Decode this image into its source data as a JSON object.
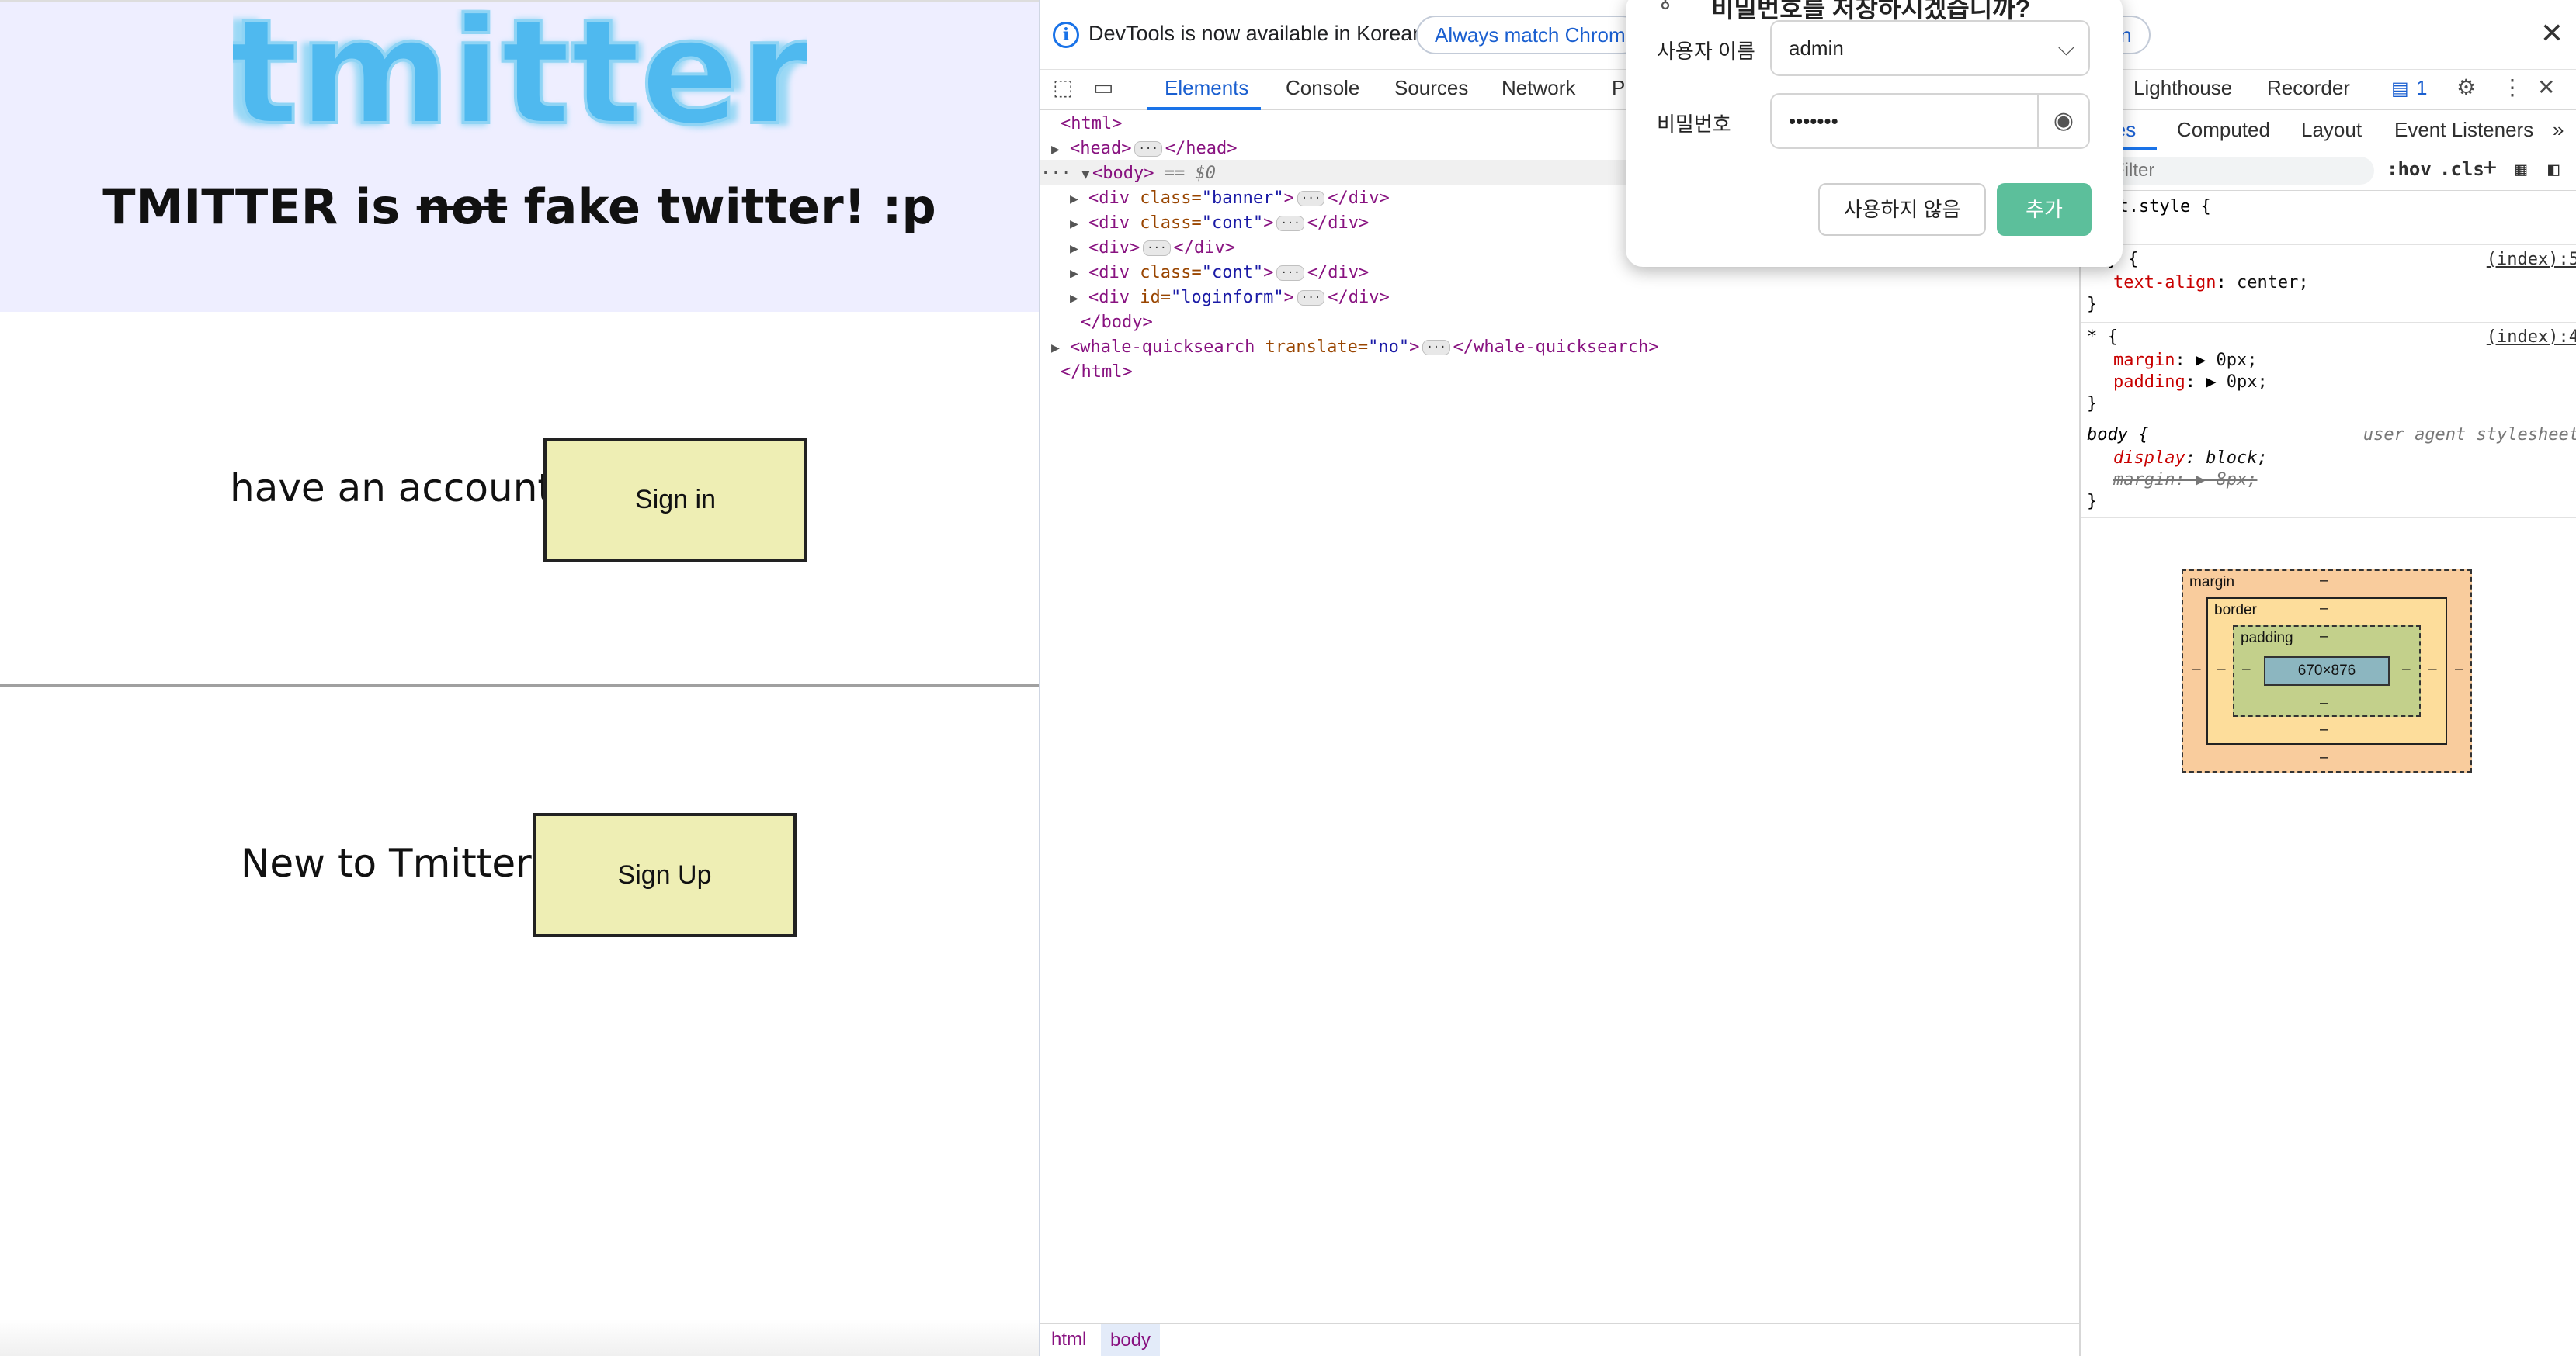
{
  "page": {
    "logo_text": "tmitter",
    "tagline_prefix": "TMITTER is ",
    "tagline_strike": "not",
    "tagline_suffix": " fake twitter! :p",
    "login_prompt": "have an account?",
    "signin_label": "Sign in",
    "signup_prompt": "New to Tmitter?",
    "signup_label": "Sign Up"
  },
  "devtools": {
    "info_text": "DevTools is now available in Korean!",
    "info_btn_match": "Always match Chrome's language",
    "info_btn_again": "w again",
    "tabs": [
      "Elements",
      "Console",
      "Sources",
      "Network",
      "Pe",
      "Lighthouse",
      "Recorder"
    ],
    "issues_count": "1",
    "dom": {
      "html_open": "<html>",
      "head": "<head>",
      "head_close": "</head>",
      "body_open": "<body>",
      "body_eq": " == $0",
      "div": "<div",
      "class_attr": " class=",
      "id_attr": " id=",
      "banner_val": "\"banner\"",
      "cont_val": "\"cont\"",
      "loginform_val": "\"loginform\"",
      "gt": ">",
      "div_plain": "<div>",
      "div_close": "</div>",
      "body_close": "</body>",
      "whale_open": "<whale-quicksearch",
      "translate_attr": " translate=",
      "translate_val": "\"no\"",
      "whale_close": "</whale-quicksearch>",
      "html_close": "</html>"
    },
    "breadcrumbs": [
      "html",
      "body"
    ],
    "subtabs": [
      "les",
      "Computed",
      "Layout",
      "Event Listeners"
    ],
    "filter_placeholder": "Filter",
    "hov": ":hov",
    "cls": ".cls",
    "css": {
      "element_style": "ent.style {",
      "rule1_selector": "ody {",
      "rule1_src": "(index):5",
      "rule1_prop": "text-align",
      "rule1_val": " center;",
      "rule2_selector": "* {",
      "rule2_src": "(index):4",
      "rule2_prop1": "margin",
      "rule2_val1": " 0px;",
      "rule2_prop2": "padding",
      "rule2_val2": " 0px;",
      "rule3_selector": "body {",
      "rule3_src": "user agent stylesheet",
      "rule3_prop1": "display",
      "rule3_val1": " block;",
      "rule3_prop2": "margin",
      "rule3_val2": " 8px;",
      "close": "}"
    },
    "boxmodel": {
      "margin": "margin",
      "border": "border",
      "padding": "padding",
      "dash": "–",
      "content": "670×876"
    }
  },
  "popup": {
    "title": "비밀번호를 저장하시겠습니까?",
    "username_label": "사용자 이름",
    "username_value": "admin",
    "password_label": "비밀번호",
    "password_value": "•••••••",
    "never_label": "사용하지 않음",
    "add_label": "추가"
  },
  "colors": {
    "banner_bg": "#eeeeff",
    "button_bg": "#eeeeb4",
    "accent": "#1a73e8",
    "popup_add": "#5cbf9b"
  }
}
